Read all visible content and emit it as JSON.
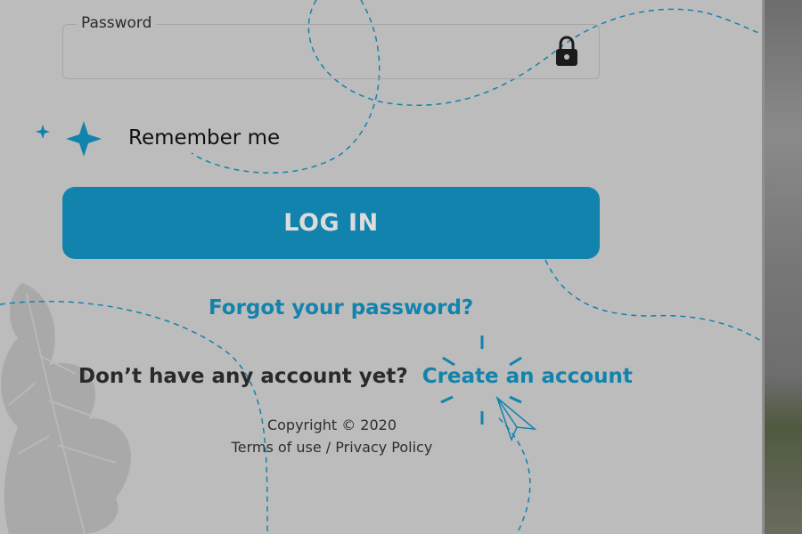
{
  "form": {
    "password": {
      "label": "Password",
      "value": "",
      "placeholder": "",
      "icon": "lock-icon"
    },
    "remember": {
      "label": "Remember me",
      "icon": "sparkle-icon"
    },
    "login_button": {
      "label": "LOG IN"
    },
    "forgot_link": "Forgot your password?"
  },
  "signup": {
    "prompt": "Don’t have any account yet?",
    "link": "Create an account"
  },
  "footer": {
    "copyright": "Copyright © 2020",
    "terms": "Terms of use",
    "separator": "/",
    "privacy": "Privacy Policy"
  },
  "colors": {
    "accent": "#1283ad",
    "overlay": "#bcbcbc",
    "text": "#111111"
  }
}
